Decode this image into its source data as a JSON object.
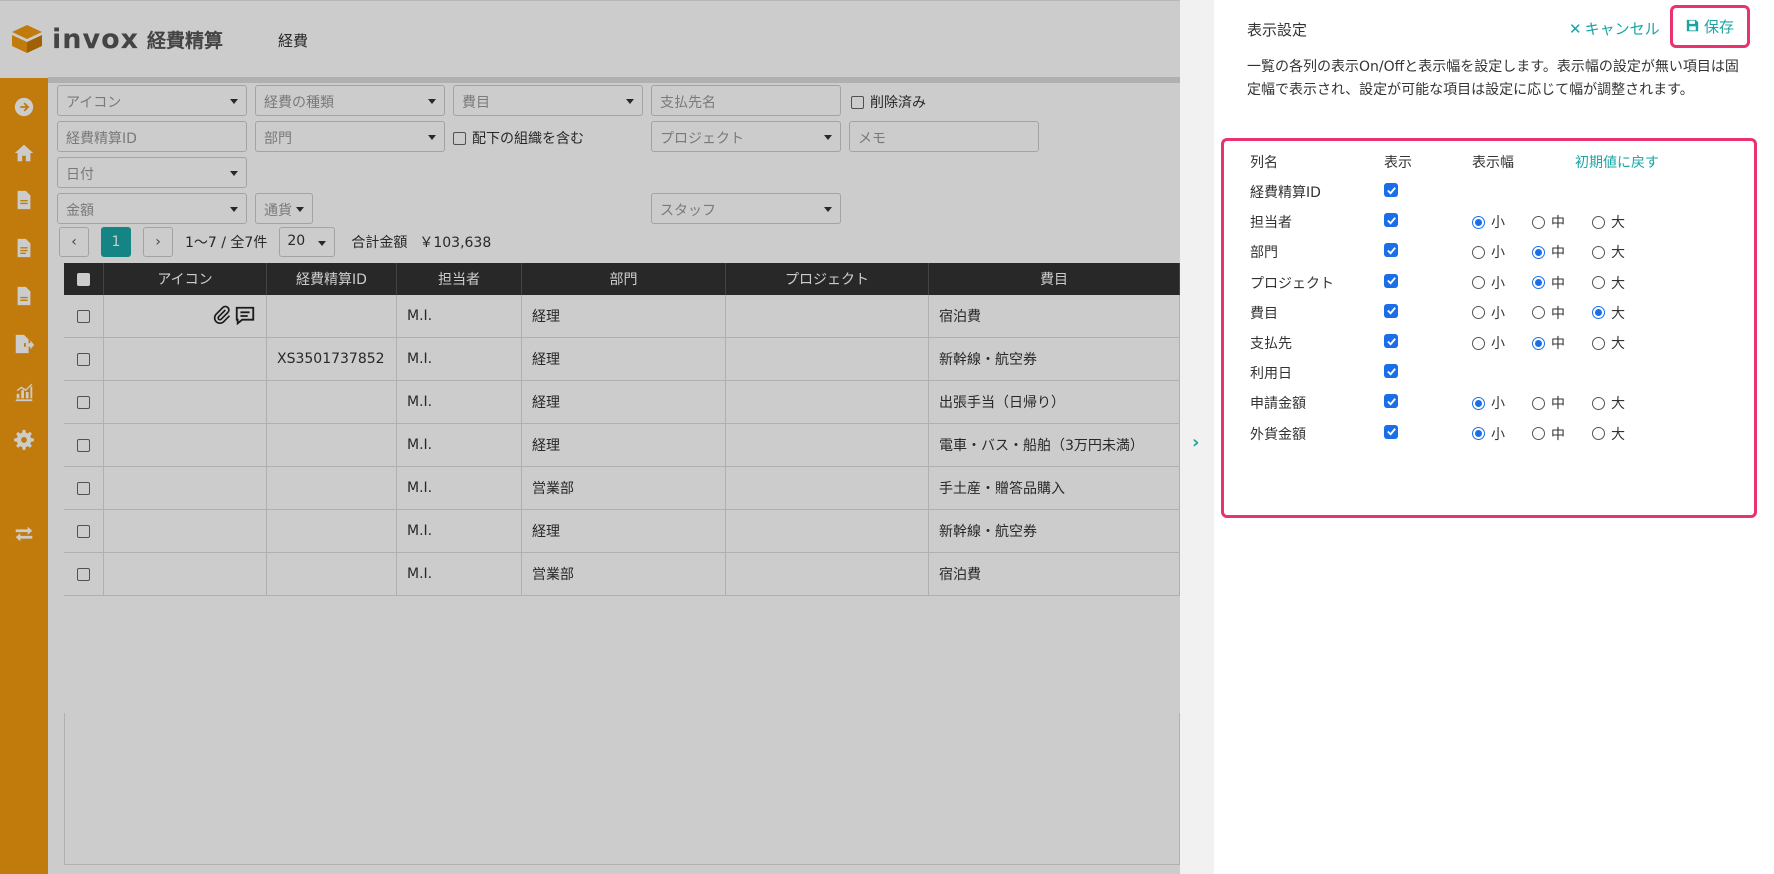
{
  "app": {
    "brand": "invox",
    "brand_sub": "経費精算",
    "nav_item": "経費",
    "brand_color": "#f29a0f",
    "accent_color": "#1aa5a5"
  },
  "sidebar": {
    "items": [
      {
        "icon": "arrow-right-circle-icon"
      },
      {
        "icon": "home-icon"
      },
      {
        "icon": "document-icon"
      },
      {
        "icon": "document-list-icon"
      },
      {
        "icon": "document-text-icon"
      },
      {
        "icon": "document-export-icon"
      },
      {
        "icon": "chart-icon"
      },
      {
        "icon": "gear-icon"
      },
      {
        "icon": "switch-icon"
      }
    ]
  },
  "filters": {
    "icon": "アイコン",
    "expense_type": "経費の種類",
    "category": "費目",
    "payee": "支払先名",
    "deleted": "削除済み",
    "expense_id": "経費精算ID",
    "department": "部門",
    "include_sub": "配下の組織を含む",
    "project": "プロジェクト",
    "memo": "メモ",
    "date": "日付",
    "amount": "金額",
    "currency": "通貨",
    "staff": "スタッフ"
  },
  "pager": {
    "prev": "‹",
    "page": "1",
    "next": "›",
    "range": "1〜7 / 全7件",
    "per_page": "20",
    "total_label": "合計金額",
    "total_value": "￥103,638"
  },
  "table": {
    "headers": [
      "アイコン",
      "経費精算ID",
      "担当者",
      "部門",
      "プロジェクト",
      "費目"
    ],
    "rows": [
      {
        "has_icons": true,
        "id": "",
        "staff": "M.I.",
        "dept": "経理",
        "project": "",
        "category": "宿泊費"
      },
      {
        "has_icons": false,
        "id": "XS3501737852",
        "staff": "M.I.",
        "dept": "経理",
        "project": "",
        "category": "新幹線・航空券"
      },
      {
        "has_icons": false,
        "id": "",
        "staff": "M.I.",
        "dept": "経理",
        "project": "",
        "category": "出張手当（日帰り）"
      },
      {
        "has_icons": false,
        "id": "",
        "staff": "M.I.",
        "dept": "経理",
        "project": "",
        "category": "電車・バス・船舶（3万円未満）"
      },
      {
        "has_icons": false,
        "id": "",
        "staff": "M.I.",
        "dept": "営業部",
        "project": "",
        "category": "手土産・贈答品購入"
      },
      {
        "has_icons": false,
        "id": "",
        "staff": "M.I.",
        "dept": "経理",
        "project": "",
        "category": "新幹線・航空券"
      },
      {
        "has_icons": false,
        "id": "",
        "staff": "M.I.",
        "dept": "営業部",
        "project": "",
        "category": "宿泊費"
      }
    ]
  },
  "panel": {
    "title": "表示設定",
    "cancel": "キャンセル",
    "save": "保存",
    "desc": "一覧の各列の表示On/Offと表示幅を設定します。表示幅の設定が無い項目は固定幅で表示され、設定が可能な項目は設定に応じて幅が調整されます。",
    "col_name": "列名",
    "col_show": "表示",
    "col_width": "表示幅",
    "reset": "初期値に戻す",
    "width_labels": [
      "小",
      "中",
      "大"
    ],
    "highlight_color": "#e8336e",
    "rows": [
      {
        "name": "経費精算ID",
        "show": true,
        "width": null
      },
      {
        "name": "担当者",
        "show": true,
        "width": 0
      },
      {
        "name": "部門",
        "show": true,
        "width": 1
      },
      {
        "name": "プロジェクト",
        "show": true,
        "width": 1
      },
      {
        "name": "費目",
        "show": true,
        "width": 2
      },
      {
        "name": "支払先",
        "show": true,
        "width": 1
      },
      {
        "name": "利用日",
        "show": true,
        "width": null
      },
      {
        "name": "申請金額",
        "show": true,
        "width": 0
      },
      {
        "name": "外貨金額",
        "show": true,
        "width": 0
      }
    ]
  }
}
